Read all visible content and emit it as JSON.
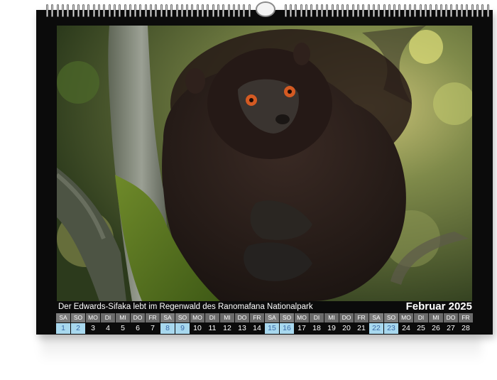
{
  "calendar": {
    "caption": "Der Edwards-Sifaka lebt im Regenwald des Ranomafana Nationalpark",
    "month_label": "Februar 2025",
    "days": [
      {
        "wd": "SA",
        "d": "1",
        "weekend": true
      },
      {
        "wd": "SO",
        "d": "2",
        "weekend": true
      },
      {
        "wd": "MO",
        "d": "3",
        "weekend": false
      },
      {
        "wd": "DI",
        "d": "4",
        "weekend": false
      },
      {
        "wd": "MI",
        "d": "5",
        "weekend": false
      },
      {
        "wd": "DO",
        "d": "6",
        "weekend": false
      },
      {
        "wd": "FR",
        "d": "7",
        "weekend": false
      },
      {
        "wd": "SA",
        "d": "8",
        "weekend": true
      },
      {
        "wd": "SO",
        "d": "9",
        "weekend": true
      },
      {
        "wd": "MO",
        "d": "10",
        "weekend": false
      },
      {
        "wd": "DI",
        "d": "11",
        "weekend": false
      },
      {
        "wd": "MI",
        "d": "12",
        "weekend": false
      },
      {
        "wd": "DO",
        "d": "13",
        "weekend": false
      },
      {
        "wd": "FR",
        "d": "14",
        "weekend": false
      },
      {
        "wd": "SA",
        "d": "15",
        "weekend": true
      },
      {
        "wd": "SO",
        "d": "16",
        "weekend": true
      },
      {
        "wd": "MO",
        "d": "17",
        "weekend": false
      },
      {
        "wd": "DI",
        "d": "18",
        "weekend": false
      },
      {
        "wd": "MI",
        "d": "19",
        "weekend": false
      },
      {
        "wd": "DO",
        "d": "20",
        "weekend": false
      },
      {
        "wd": "FR",
        "d": "21",
        "weekend": false
      },
      {
        "wd": "SA",
        "d": "22",
        "weekend": true
      },
      {
        "wd": "SO",
        "d": "23",
        "weekend": true
      },
      {
        "wd": "MO",
        "d": "24",
        "weekend": false
      },
      {
        "wd": "DI",
        "d": "25",
        "weekend": false
      },
      {
        "wd": "MI",
        "d": "26",
        "weekend": false
      },
      {
        "wd": "DO",
        "d": "27",
        "weekend": false
      },
      {
        "wd": "FR",
        "d": "28",
        "weekend": false
      }
    ]
  },
  "colors": {
    "calendar_background": "#0b0b0b",
    "weekday_header": "#6b6b6b",
    "weekend_highlight": "#a8d8ee",
    "weekend_text": "#3a6aa8"
  },
  "icons": [
    "wire-binding-icon",
    "hanger-hook-icon"
  ]
}
